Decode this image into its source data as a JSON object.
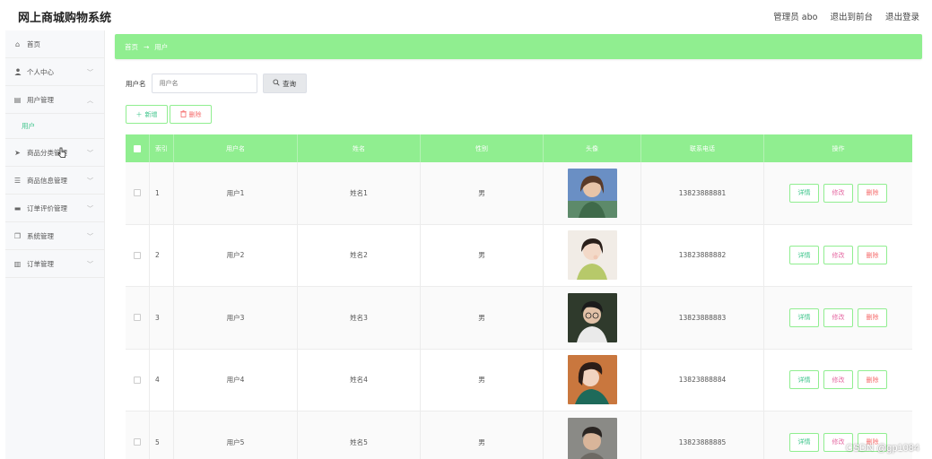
{
  "app": {
    "title": "网上商城购物系统"
  },
  "top_actions": [
    "管理员 abo",
    "退出到前台",
    "退出登录"
  ],
  "sidebar": {
    "items": [
      {
        "label": "首页",
        "icon": "home-icon",
        "glyph": "⌂"
      },
      {
        "label": "个人中心",
        "icon": "user-icon",
        "glyph": "👤",
        "chevron": "﹀"
      },
      {
        "label": "用户管理",
        "icon": "user-manage-icon",
        "glyph": "▤",
        "chevron": "︿"
      },
      {
        "label": "用户",
        "sub": true
      },
      {
        "label": "商品分类管理",
        "icon": "send-icon",
        "glyph": "➤",
        "chevron": "﹀"
      },
      {
        "label": "商品信息管理",
        "icon": "menu-icon",
        "glyph": "☰",
        "chevron": "﹀"
      },
      {
        "label": "订单评价管理",
        "icon": "chat-icon",
        "glyph": "▬",
        "chevron": "﹀"
      },
      {
        "label": "系统管理",
        "icon": "copy-icon",
        "glyph": "❐",
        "chevron": "﹀"
      },
      {
        "label": "订单管理",
        "icon": "chart-icon",
        "glyph": "▥",
        "chevron": "﹀"
      }
    ]
  },
  "breadcrumb": {
    "home": "首页",
    "arrow": "→",
    "current": "用户"
  },
  "search": {
    "label": "用户名",
    "placeholder": "用户名",
    "button": "查询"
  },
  "actions": {
    "add": "新增",
    "delete": "删除"
  },
  "table": {
    "headers": [
      "",
      "索引",
      "用户名",
      "姓名",
      "性别",
      "头像",
      "联系电话",
      "操作"
    ],
    "rows": [
      {
        "index": "1",
        "username": "用户1",
        "name": "姓名1",
        "gender": "男",
        "phone": "13823888881"
      },
      {
        "index": "2",
        "username": "用户2",
        "name": "姓名2",
        "gender": "男",
        "phone": "13823888882"
      },
      {
        "index": "3",
        "username": "用户3",
        "name": "姓名3",
        "gender": "男",
        "phone": "13823888883"
      },
      {
        "index": "4",
        "username": "用户4",
        "name": "姓名4",
        "gender": "男",
        "phone": "13823888884"
      },
      {
        "index": "5",
        "username": "用户5",
        "name": "姓名5",
        "gender": "男",
        "phone": "13823888885"
      }
    ],
    "ops": {
      "detail": "详情",
      "edit": "修改",
      "delete": "删除"
    }
  },
  "colors": {
    "accent": "#90ee90",
    "active_text": "#3cc48a",
    "danger": "#f56c6c"
  },
  "watermark": "CSDN @gp1084"
}
